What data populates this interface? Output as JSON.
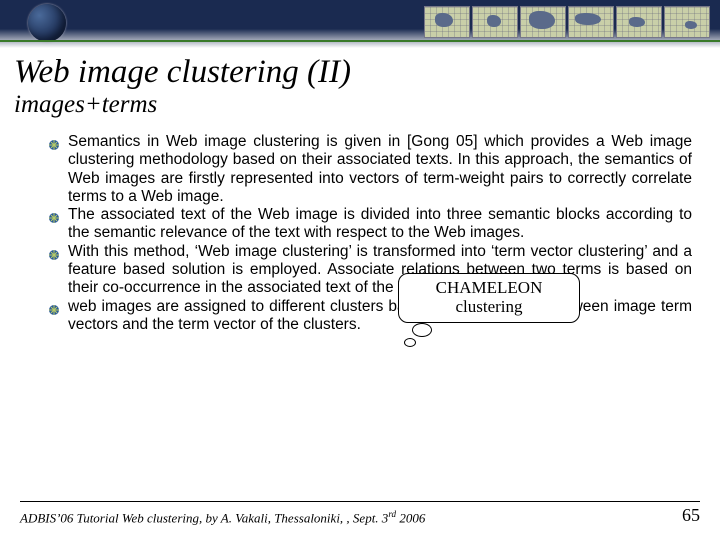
{
  "title": "Web image clustering  (II)",
  "subtitle": "images+terms",
  "bullets": [
    "Semantics in Web image clustering is given in  [Gong 05]  which provides a Web image clustering methodology based on their associated texts. In this approach, the semantics of Web images are firstly represented into vectors of term-weight pairs to correctly correlate terms to a Web image.",
    "The associated text of the Web image is divided into three semantic blocks according to the semantic relevance of the text with respect to the Web images.",
    "With this method, ‘Web image clustering’ is transformed into ‘term vector clustering’ and a feature based solution is employed. Associate relations between two terms is based on their co-occurrence in the associated text of the Web images.",
    "web images are assigned to different clusters based on the similarity between image term vectors and the term vector of the clusters."
  ],
  "callout": {
    "line1": "CHAMELEON",
    "line2": "clustering"
  },
  "footer": {
    "left_prefix": "ADBIS’06 Tutorial Web clustering, by A. Vakali, Thessaloniki, , Sept. 3",
    "left_super": "rd",
    "left_suffix": " 2006",
    "page": "65"
  }
}
